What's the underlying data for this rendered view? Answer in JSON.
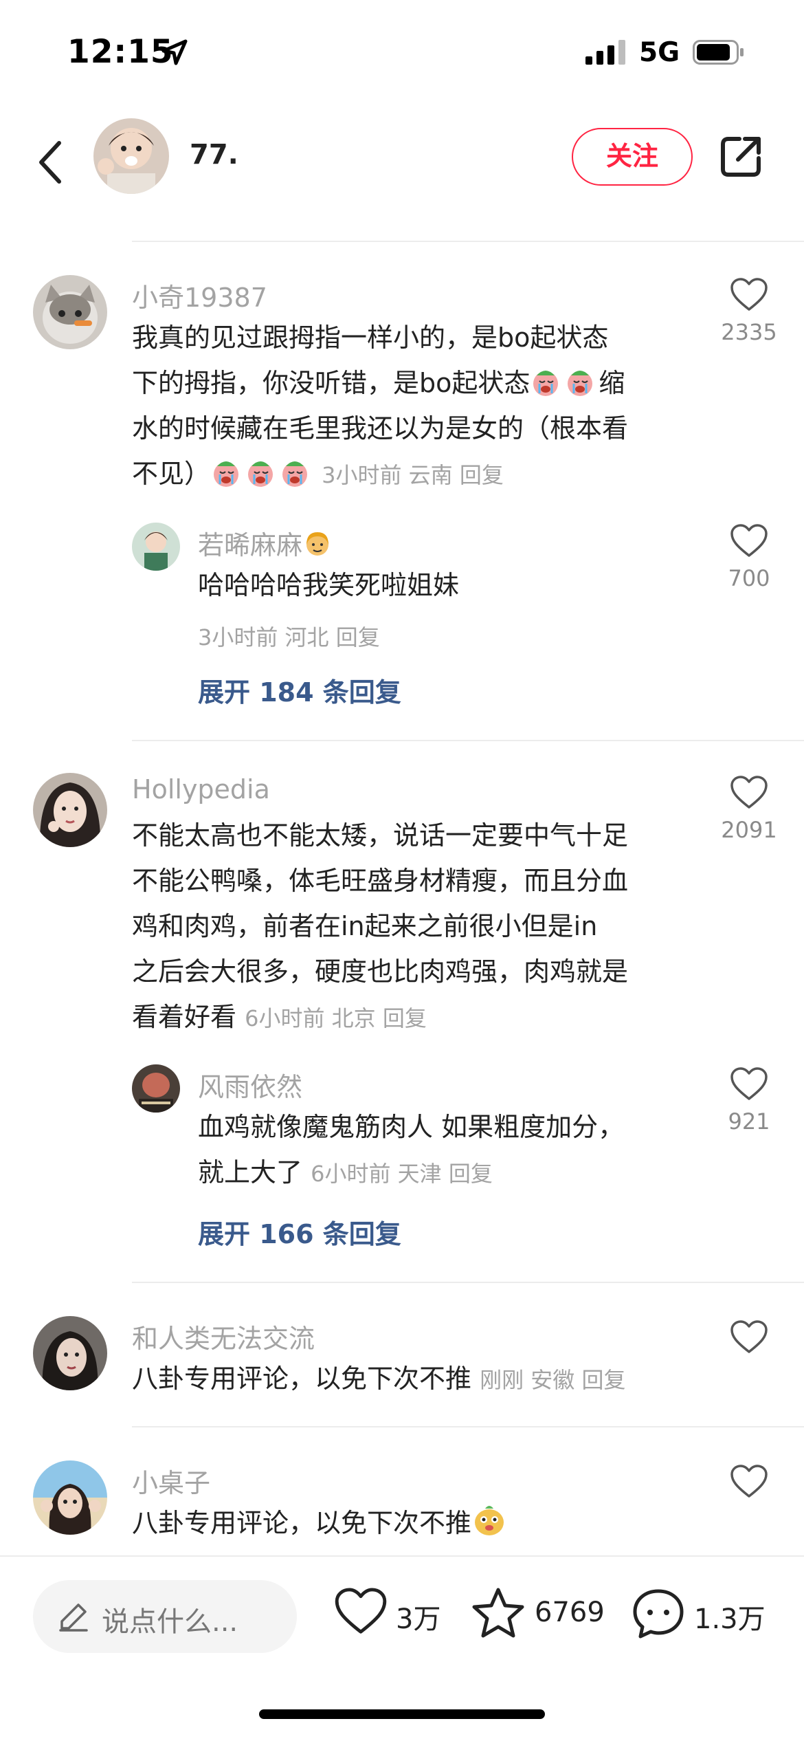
{
  "status_bar": {
    "time": "12:15",
    "network": "5G"
  },
  "header": {
    "username": "77.",
    "follow_label": "关注"
  },
  "comments": [
    {
      "username": "小奇19387",
      "text_lines": [
        "我真的见过跟拇指一样小的，是bo起状态",
        "下的拇指，你没听错，是bo起状态",
        "水的时候藏在毛里我还以为是女的（根本看",
        "不见）"
      ],
      "inline_text_after_emoji": "缩",
      "meta": "3小时前 云南 回复",
      "likes": "2335",
      "reply": {
        "username": "若晞麻麻",
        "text": "哈哈哈哈我笑死啦姐妹",
        "meta": "3小时前 河北 回复",
        "likes": "700"
      },
      "expand_label": "展开 184 条回复"
    },
    {
      "username": "Hollypedia",
      "text_lines": [
        "不能太高也不能太矮，说话一定要中气十足",
        "不能公鸭嗓，体毛旺盛身材精瘦，而且分血",
        "鸡和肉鸡，前者在in起来之前很小但是in",
        "之后会大很多，硬度也比肉鸡强，肉鸡就是",
        "看着好看"
      ],
      "meta": "6小时前 北京 回复",
      "likes": "2091",
      "reply": {
        "username": "风雨依然",
        "text_lines": [
          "血鸡就像魔鬼筋肉人 如果粗度加分，",
          "就上大了"
        ],
        "meta": "6小时前 天津 回复",
        "likes": "921"
      },
      "expand_label": "展开 166 条回复"
    },
    {
      "username": "和人类无法交流",
      "text": "八卦专用评论，以免下次不推",
      "meta": "刚刚 安徽 回复",
      "likes": ""
    },
    {
      "username": "小桌子",
      "text": "八卦专用评论，以免下次不推",
      "likes": ""
    }
  ],
  "bottom_bar": {
    "input_placeholder": "说点什么...",
    "likes": "3万",
    "collects": "6769",
    "comments": "1.3万"
  }
}
